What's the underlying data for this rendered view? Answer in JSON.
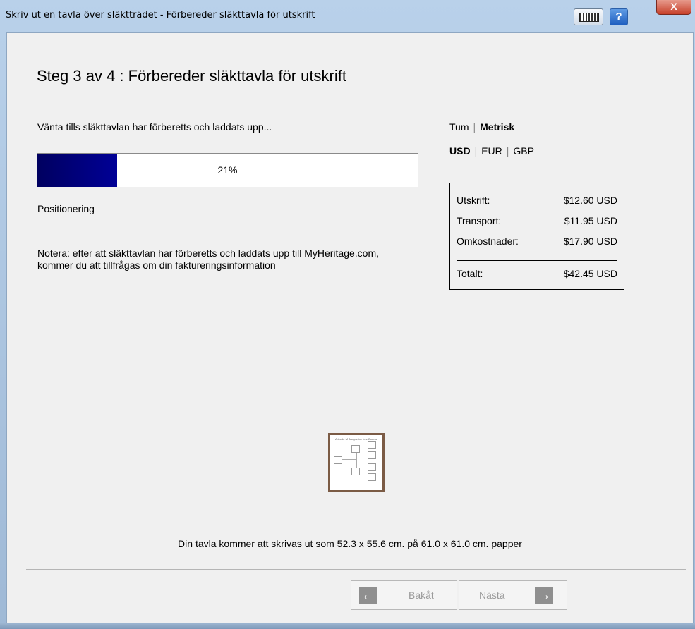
{
  "window": {
    "title": "Skriv ut en tavla över släktträdet - Förbereder släkttavla för utskrift",
    "help_label": "?",
    "close_label": "X"
  },
  "step": {
    "title": "Steg 3 av 4 : Förbereder släkttavla för utskrift"
  },
  "progress": {
    "message": "Vänta tills släkttavlan har förberetts och laddats upp...",
    "value": 0.21,
    "label": "21%",
    "status": "Positionering",
    "note": "Notera: efter att släkttavlan har förberetts och laddats upp till MyHeritage.com, kommer du att tillfrågas om din faktureringsinformation"
  },
  "units": {
    "options": [
      "Tum",
      "Metrisk"
    ],
    "selected": "Metrisk"
  },
  "currency": {
    "options": [
      "USD",
      "EUR",
      "GBP"
    ],
    "selected": "USD"
  },
  "pricing": {
    "rows": [
      {
        "label": "Utskrift:",
        "value": "$12.60 USD"
      },
      {
        "label": "Transport:",
        "value": "$11.95 USD"
      },
      {
        "label": "Omkostnader:",
        "value": "$17.90 USD"
      }
    ],
    "total": {
      "label": "Totalt:",
      "value": "$42.45 USD"
    }
  },
  "preview": {
    "thumb_title": "Arthelie M Jacqueline Lee Bourne",
    "print_info": "Din tavla kommer att skrivas ut som 52.3 x 55.6 cm. på 61.0 x 61.0 cm. papper"
  },
  "navigation": {
    "back_label": "Bakåt",
    "back_icon": "arrow-left-icon",
    "next_label": "Nästa",
    "next_icon": "arrow-right-icon"
  },
  "colors": {
    "progress_fill": "#000096",
    "thumb_frame": "#7b5b45",
    "close_button": "#c7412b"
  }
}
